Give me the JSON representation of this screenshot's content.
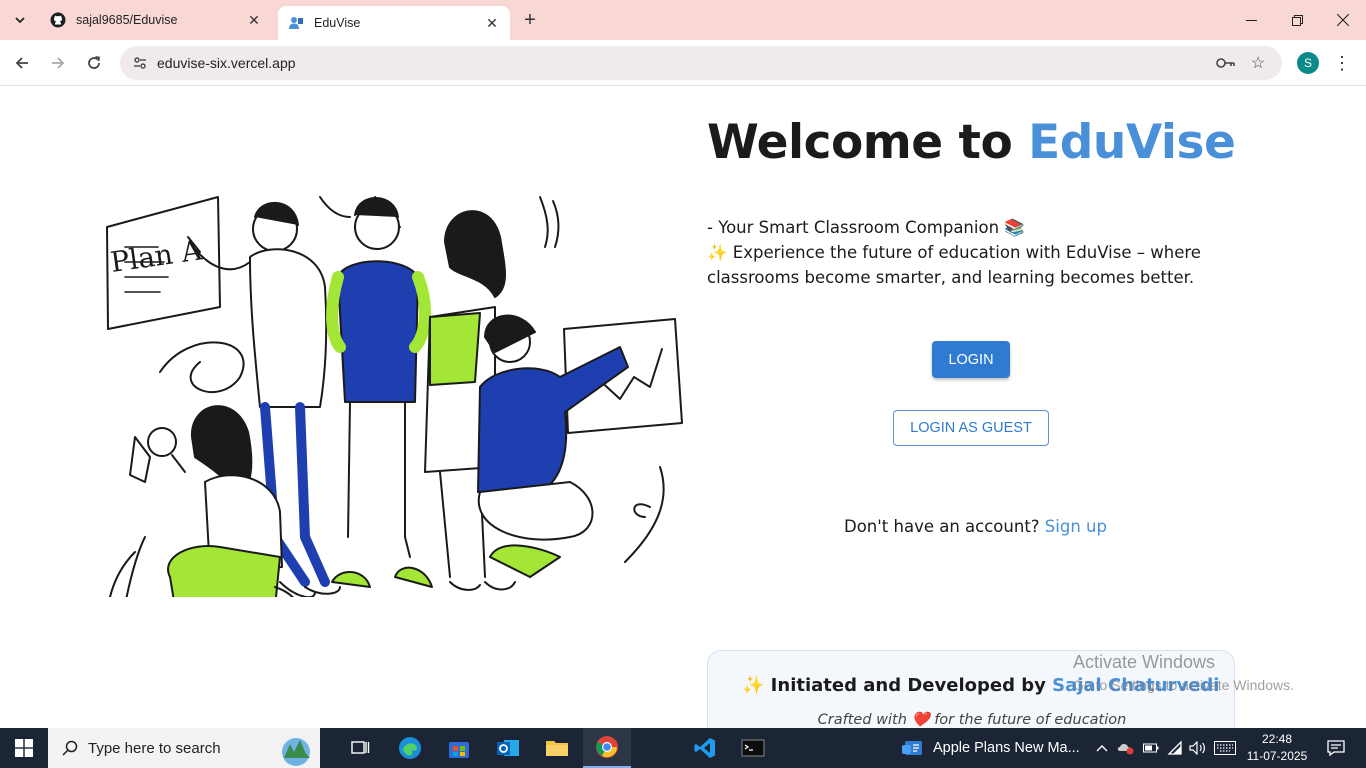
{
  "browser": {
    "tabs": [
      {
        "title": "sajal9685/Eduvise",
        "icon": "github-icon",
        "active": false
      },
      {
        "title": "EduVise",
        "icon": "eduvise-icon",
        "active": true
      }
    ],
    "url": "eduvise-six.vercel.app",
    "profile_initial": "S"
  },
  "hero": {
    "title_prefix": "Welcome to ",
    "title_brand": "EduVise",
    "tagline": "- Your Smart Classroom Companion 📚",
    "description": "✨ Experience the future of education with EduVise – where classrooms become smarter, and learning becomes better."
  },
  "illustration": {
    "board_text": "Plan A"
  },
  "actions": {
    "login_label": "LOGIN",
    "guest_label": "LOGIN AS GUEST",
    "signup_prompt": "Don't have an account?",
    "signup_link": "Sign up"
  },
  "credits": {
    "prefix": "✨ Initiated and Developed by ",
    "author": "Sajal Chaturvedi",
    "tagline_before": "Crafted with",
    "heart": "❤️",
    "tagline_after": "for the future of education"
  },
  "watermark": {
    "title": "Activate Windows",
    "subtitle": "Go to Settings to activate Windows."
  },
  "taskbar": {
    "search_placeholder": "Type here to search",
    "news": "Apple Plans New Ma...",
    "time": "22:48",
    "date": "11-07-2025"
  },
  "colors": {
    "brand": "#4a90d9",
    "button": "#2f7bd1",
    "tabstrip": "#f9d7d4",
    "taskbar": "#1c2535",
    "illustration_green": "#a3e635",
    "illustration_blue": "#1f3fb0"
  }
}
